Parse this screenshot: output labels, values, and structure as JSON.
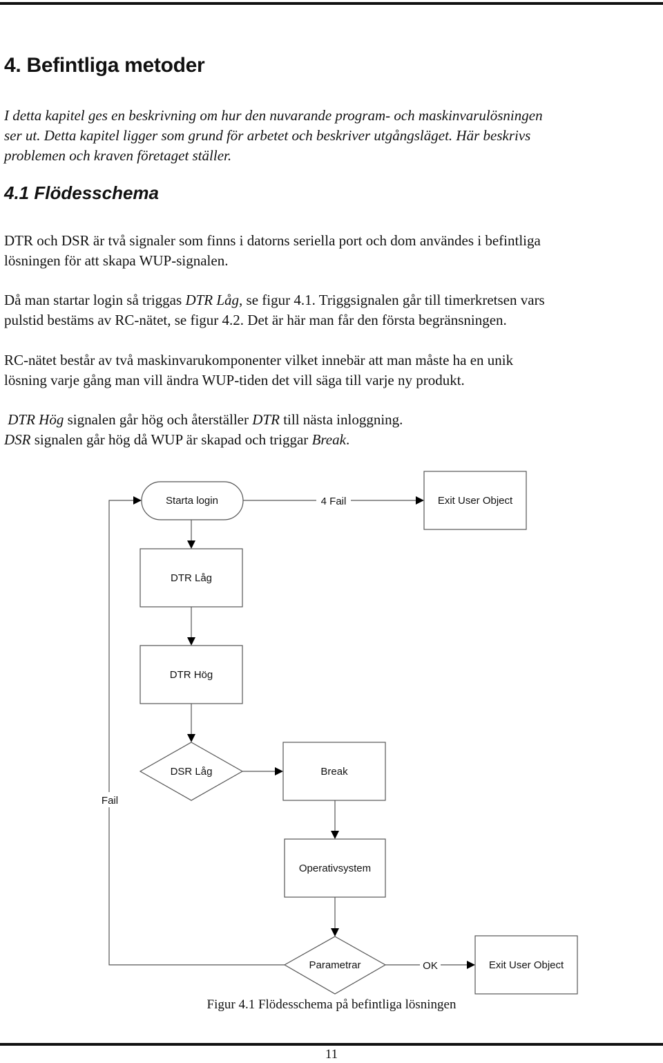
{
  "heading": "4. Befintliga metoder",
  "intro": [
    "I detta kapitel ges en beskrivning om hur den nuvarande program- och maskinvarulösningen",
    "ser ut. Detta kapitel ligger som grund för arbetet och beskriver utgångsläget. Här beskrivs",
    "problemen och kraven företaget ställer."
  ],
  "section": {
    "title": "4.1 Flödesschema",
    "p1": [
      "DTR och DSR är två signaler som finns i datorns seriella port och dom användes i befintliga",
      "lösningen för att skapa WUP-signalen."
    ],
    "p2": {
      "l1_a": "Då man startar login så triggas ",
      "l1_em": "DTR Låg",
      "l1_b": ", se figur 4.1. Triggsignalen går till timerkretsen vars",
      "l2": "pulstid bestäms av RC-nätet, se figur 4.2. Det är här man får den första begränsningen."
    },
    "p3": [
      "RC-nätet består av två maskinvarukomponenter vilket innebär att man måste ha en unik",
      "lösning varje gång man vill ändra WUP-tiden det vill säga till varje ny produkt."
    ],
    "p4": {
      "l1_em1": "DTR Hög",
      "l1_a": " signalen går hög och återställer ",
      "l1_em2": "DTR",
      "l1_b": " till nästa inloggning.",
      "l2_em1": "DSR",
      "l2_a": " signalen går hög då WUP är skapad och triggar ",
      "l2_em2": "Break",
      "l2_b": "."
    }
  },
  "flowchart": {
    "nodes": {
      "start": "Starta login",
      "exit1": "Exit User Object",
      "dtr_lag": "DTR Låg",
      "dtr_hog": "DTR Hög",
      "dsr_lag": "DSR Låg",
      "break": "Break",
      "os": "Operativsystem",
      "params": "Parametrar",
      "exit2": "Exit User Object"
    },
    "edge_labels": {
      "four_fail": "4 Fail",
      "fail": "Fail",
      "ok": "OK"
    }
  },
  "caption": "Figur 4.1 Flödesschema på befintliga lösningen",
  "page_number": "11"
}
